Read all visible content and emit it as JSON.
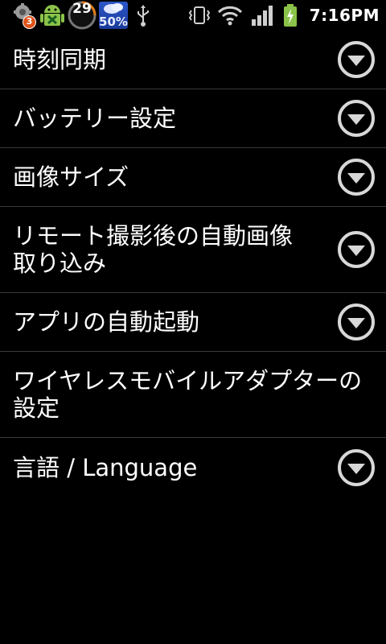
{
  "status_bar": {
    "notification_count": "3",
    "temperature": "29",
    "weather_value": "50%",
    "time": "7:16PM",
    "icons": [
      "gear-notification-icon",
      "android-app-icon",
      "temperature-ring-icon",
      "weather-icon",
      "usb-icon",
      "vibrate-icon",
      "wifi-icon",
      "signal-icon",
      "battery-charging-icon"
    ]
  },
  "settings": {
    "items": [
      {
        "label": "時刻同期",
        "has_dropdown": true
      },
      {
        "label": "バッテリー設定",
        "has_dropdown": true
      },
      {
        "label": "画像サイズ",
        "has_dropdown": true
      },
      {
        "label_line1": "リモート撮影後の自動画像",
        "label_line2": "取り込み",
        "has_dropdown": true
      },
      {
        "label": "アプリの自動起動",
        "has_dropdown": true
      },
      {
        "label_line1": "ワイヤレスモバイルアダプターの",
        "label_line2": "設定",
        "has_dropdown": false
      },
      {
        "label": "言語 / Language",
        "has_dropdown": true
      }
    ]
  },
  "colors": {
    "background": "#000000",
    "divider": "#3a3a3a",
    "text": "#ffffff",
    "icon_ring": "#d8d8d8"
  }
}
